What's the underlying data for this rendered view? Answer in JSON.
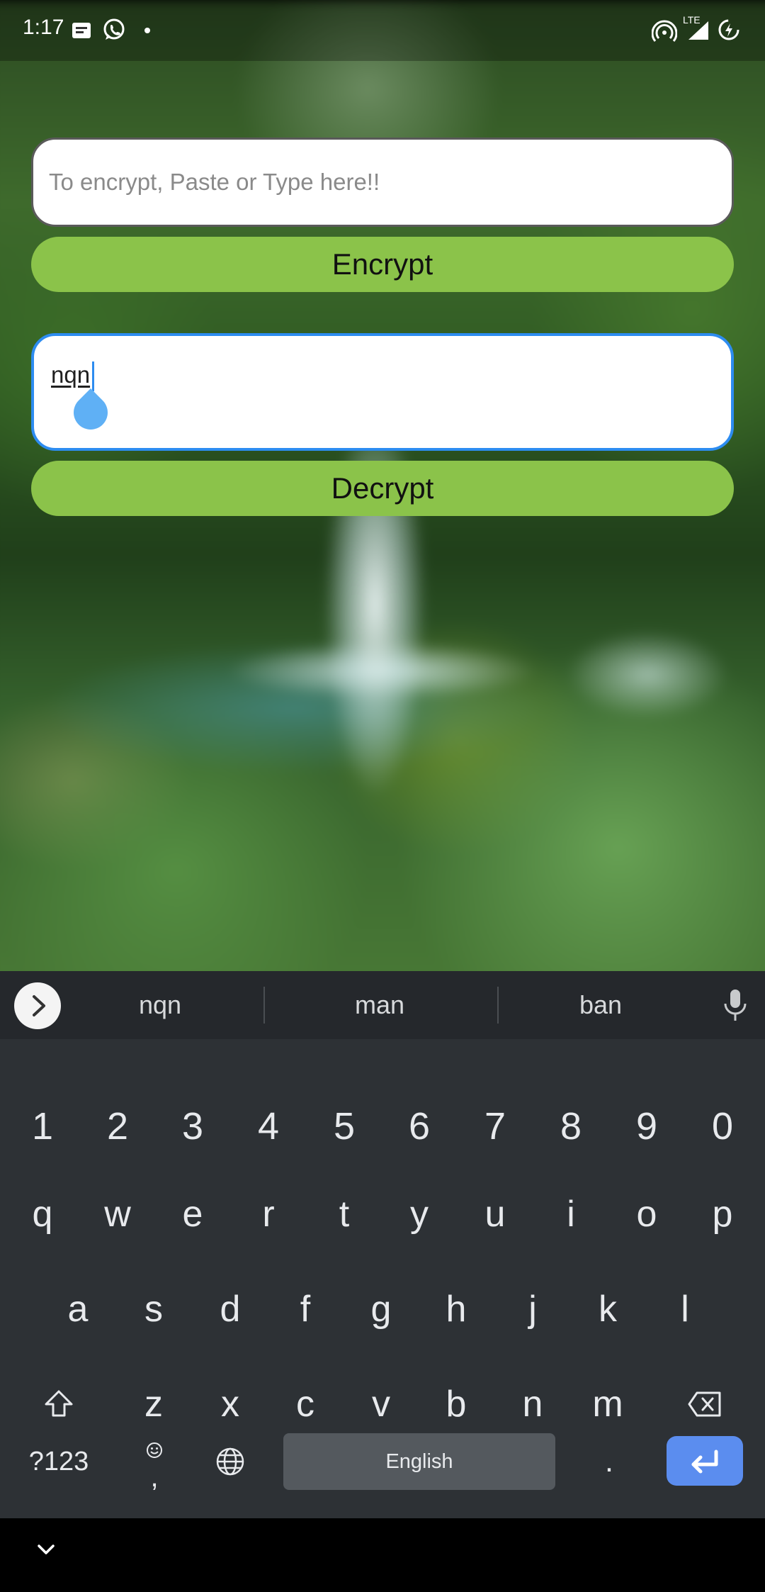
{
  "status_bar": {
    "time": "1:17",
    "network_label": "LTE",
    "left_icons": [
      "message-icon",
      "whatsapp-icon",
      "dot-icon"
    ],
    "right_icons": [
      "hotspot-icon",
      "signal-icon",
      "battery-charging-icon"
    ]
  },
  "encrypt": {
    "placeholder": "To encrypt, Paste or Type here!!",
    "value": "",
    "button_label": "Encrypt"
  },
  "decrypt": {
    "value": "nqn",
    "button_label": "Decrypt"
  },
  "keyboard": {
    "suggestions": [
      "nqn",
      "man",
      "ban"
    ],
    "number_row": [
      "1",
      "2",
      "3",
      "4",
      "5",
      "6",
      "7",
      "8",
      "9",
      "0"
    ],
    "row1": [
      "q",
      "w",
      "e",
      "r",
      "t",
      "y",
      "u",
      "i",
      "o",
      "p"
    ],
    "row2": [
      "a",
      "s",
      "d",
      "f",
      "g",
      "h",
      "j",
      "k",
      "l"
    ],
    "row3": [
      "z",
      "x",
      "c",
      "v",
      "b",
      "n",
      "m"
    ],
    "symbols_label": "?123",
    "comma_label": ",",
    "period_label": ".",
    "space_label": "English"
  },
  "colors": {
    "accent_button": "#8bc34a",
    "focus_border": "#2d8cf0",
    "enter_key": "#5b8def",
    "keyboard_bg": "#2d3135"
  }
}
